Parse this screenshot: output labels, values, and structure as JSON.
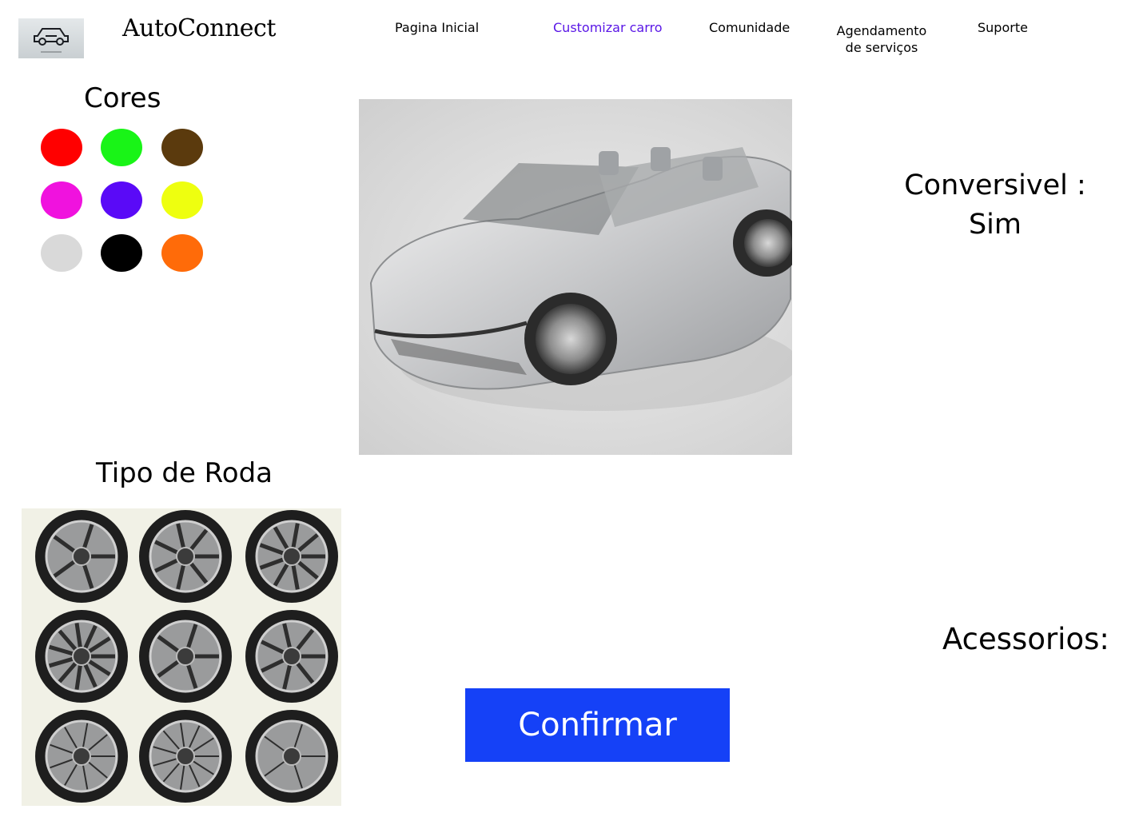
{
  "header": {
    "brand": "AutoConnect",
    "nav": [
      {
        "label": "Pagina Inicial",
        "active": false
      },
      {
        "label": "Customizar carro",
        "active": true
      },
      {
        "label": "Comunidade",
        "active": false
      },
      {
        "label": "Agendamento de serviços",
        "active": false
      },
      {
        "label": "Suporte",
        "active": false
      }
    ]
  },
  "colors": {
    "title": "Cores",
    "swatches": [
      "#ff0000",
      "#19f417",
      "#5b3a0d",
      "#f012de",
      "#5a0af7",
      "#eeff0f",
      "#d9d9d9",
      "#000000",
      "#ff6b09"
    ]
  },
  "car": {
    "icon": "convertible-car-image"
  },
  "convertible": {
    "label": "Conversivel :",
    "value": "Sim"
  },
  "wheels": {
    "title": "Tipo de Roda",
    "icon": "wheel-options-image"
  },
  "accessories": {
    "title": "Acessorios:"
  },
  "actions": {
    "confirm_label": "Confirmar",
    "confirm_color": "#1541f7",
    "active_nav_color": "#5a17e6"
  }
}
